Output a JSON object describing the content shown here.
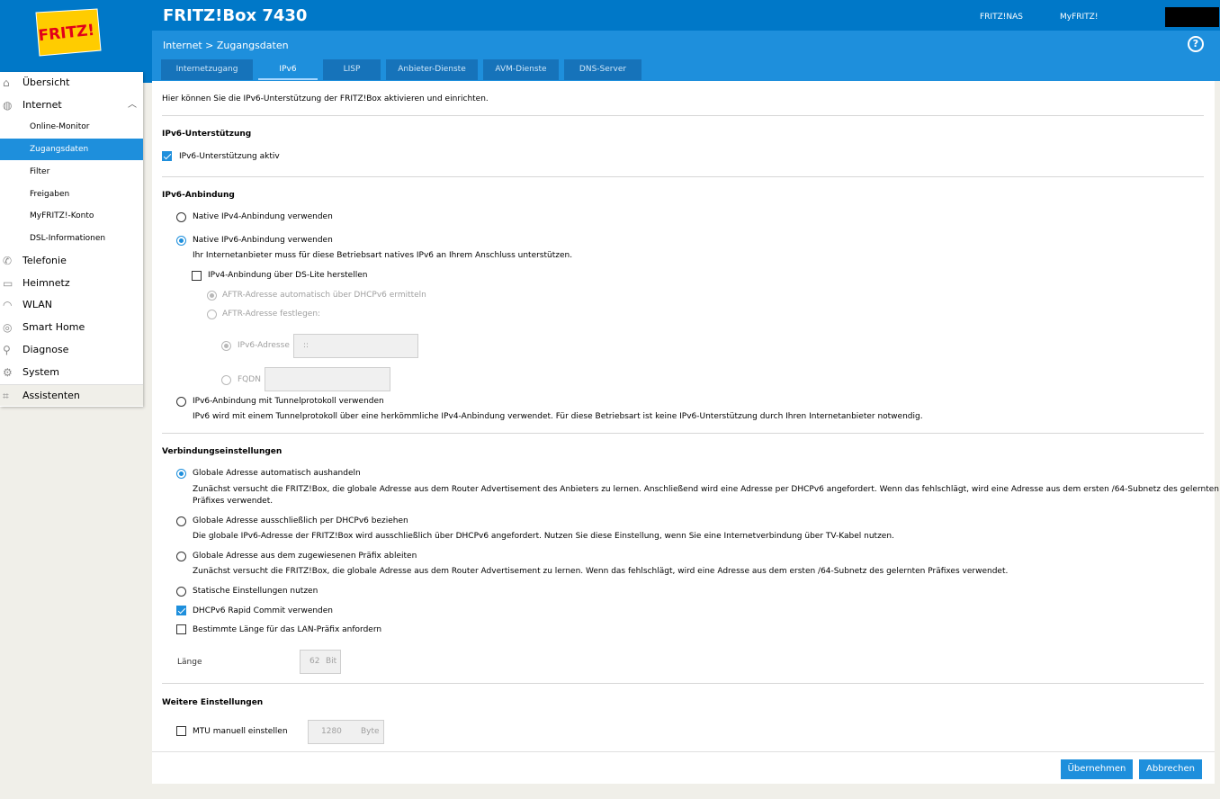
{
  "header": {
    "logo_text": "FRITZ!",
    "product_title": "FRITZ!Box 7430",
    "nav_nas": "FRITZ!NAS",
    "nav_myfritz": "MyFRITZ!"
  },
  "subbar": {
    "breadcrumb": "Internet > Zugangsdaten",
    "help_label": "?",
    "tabs": [
      {
        "label": "Internetzugang"
      },
      {
        "label": "IPv6"
      },
      {
        "label": "LISP"
      },
      {
        "label": "Anbieter-Dienste"
      },
      {
        "label": "AVM-Dienste"
      },
      {
        "label": "DNS-Server"
      }
    ]
  },
  "sidebar": {
    "items": [
      {
        "label": "Übersicht",
        "icon": "home-icon"
      },
      {
        "label": "Internet",
        "icon": "globe-icon"
      },
      {
        "label": "Telefonie",
        "icon": "phone-icon"
      },
      {
        "label": "Heimnetz",
        "icon": "network-icon"
      },
      {
        "label": "WLAN",
        "icon": "wifi-icon"
      },
      {
        "label": "Smart Home",
        "icon": "smart-home-icon"
      },
      {
        "label": "Diagnose",
        "icon": "diagnose-icon"
      },
      {
        "label": "System",
        "icon": "system-icon"
      },
      {
        "label": "Assistenten",
        "icon": "assistant-icon"
      }
    ],
    "sub_items": [
      {
        "label": "Online-Monitor"
      },
      {
        "label": "Zugangsdaten"
      },
      {
        "label": "Filter"
      },
      {
        "label": "Freigaben"
      },
      {
        "label": "MyFRITZ!-Konto"
      },
      {
        "label": "DSL-Informationen"
      }
    ]
  },
  "content": {
    "intro": "Hier können Sie die IPv6-Unterstützung der FRITZ!Box aktivieren und einrichten.",
    "sec_support": {
      "title": "IPv6-Unterstützung",
      "checkbox_label": "IPv6-Unterstützung aktiv"
    },
    "sec_binding": {
      "title": "IPv6-Anbindung",
      "opt_native_ipv4": "Native IPv4-Anbindung verwenden",
      "opt_native_ipv6": "Native IPv6-Anbindung verwenden",
      "opt_native_ipv6_desc": "Ihr Internetanbieter muss für diese Betriebsart natives IPv6 an Ihrem Anschluss unterstützen.",
      "dslite_label": "IPv4-Anbindung über DS-Lite herstellen",
      "aftr_auto": "AFTR-Adresse automatisch über DHCPv6 ermitteln",
      "aftr_fixed": "AFTR-Adresse festlegen:",
      "ipv6_addr_label": "IPv6-Adresse",
      "ipv6_addr_value": "::",
      "fqdn_label": "FQDN",
      "opt_tunnel": "IPv6-Anbindung mit Tunnelprotokoll verwenden",
      "opt_tunnel_desc": "IPv6 wird mit einem Tunnelprotokoll über eine herkömmliche IPv4-Anbindung verwendet. Für diese Betriebsart ist keine IPv6-Unterstützung durch Ihren Internetanbieter notwendig."
    },
    "sec_connection": {
      "title": "Verbindungseinstellungen",
      "opt_auto": "Globale Adresse automatisch aushandeln",
      "opt_auto_desc1": "Zunächst versucht die FRITZ!Box, die globale Adresse aus dem Router Advertisement des Anbieters zu lernen. Anschließend wird eine Adresse per DHCPv6 angefordert. Wenn das fehlschlägt, wird eine Adresse aus dem ersten /64-Subnetz des gelernten",
      "opt_auto_desc2": "Präfixes verwendet.",
      "opt_dhcp": "Globale Adresse ausschließlich per DHCPv6 beziehen",
      "opt_dhcp_desc": "Die globale IPv6-Adresse der FRITZ!Box wird ausschließlich über DHCPv6 angefordert. Nutzen Sie diese Einstellung, wenn Sie eine Internetverbindung über TV-Kabel nutzen.",
      "opt_prefix": "Globale Adresse aus dem zugewiesenen Präfix ableiten",
      "opt_prefix_desc": "Zunächst versucht die FRITZ!Box, die globale Adresse aus dem Router Advertisement zu lernen. Wenn das fehlschlägt, wird eine Adresse aus dem ersten /64-Subnetz des gelernten Präfixes verwendet.",
      "opt_static": "Statische Einstellungen nutzen",
      "rapid_commit": "DHCPv6 Rapid Commit verwenden",
      "lan_prefix": "Bestimmte Länge für das LAN-Präfix anfordern",
      "length_label": "Länge",
      "length_value": "62",
      "length_unit": "Bit"
    },
    "sec_more": {
      "title": "Weitere Einstellungen",
      "mtu_label": "MTU manuell einstellen",
      "mtu_value": "1280",
      "mtu_unit": "Byte"
    }
  },
  "footer": {
    "apply_label": "Übernehmen",
    "cancel_label": "Abbrechen"
  },
  "colors": {
    "brand_blue": "#0078c8",
    "accent_blue": "#1e8fdc",
    "logo_red": "#e2001a",
    "logo_yellow": "#ffcc00"
  }
}
